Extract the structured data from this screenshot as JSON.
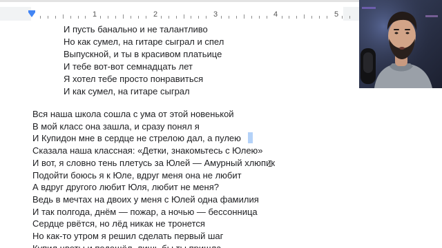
{
  "ruler": {
    "numbers": [
      "1",
      "2",
      "3",
      "4",
      "5"
    ]
  },
  "document": {
    "stanza1": [
      "И пусть банально и не талантливо",
      "Но как сумел, на гитаре сыграл и спел",
      "Выпускной, и ты в красивом платьице",
      "И тебе вот-вот семнадцать лет",
      "Я хотел тебе просто понравиться",
      "И как сумел, на гитаре сыграл"
    ],
    "stanza2": [
      "Вся наша школа сошла с ума от этой новенькой",
      "В мой класс она зашла, и сразу понял я",
      "И Купидон мне в сердце не стрелою дал, а пулею",
      "Сказала наша классная: «Детки, знакомьтесь с Юлею»",
      "И вот, я словно тень плетусь за Юлей — Амурный хлюпик",
      "Подойти боюсь я к Юле, вдруг меня она не любит",
      "А вдруг другого любит Юля, любит не меня?",
      "Ведь в мечтах на двоих у меня с Юлей одна фамилия",
      "И так полгода, днём — пожар, а ночью — бессонница",
      "Сердце рвётся, но лёд никак не тронется",
      "Но как-то утром я решил сделать первый шаг",
      "Купил цветы и подошёл, лишь бы ты пришла"
    ]
  },
  "colors": {
    "text": "#202124",
    "indent_marker": "#4285f4",
    "selection": "#b4d2f8",
    "ruler_margin": "#f1f3f4"
  },
  "icons": {
    "indent": "first-line-indent-marker-icon",
    "cursor": "text-cursor-icon"
  }
}
